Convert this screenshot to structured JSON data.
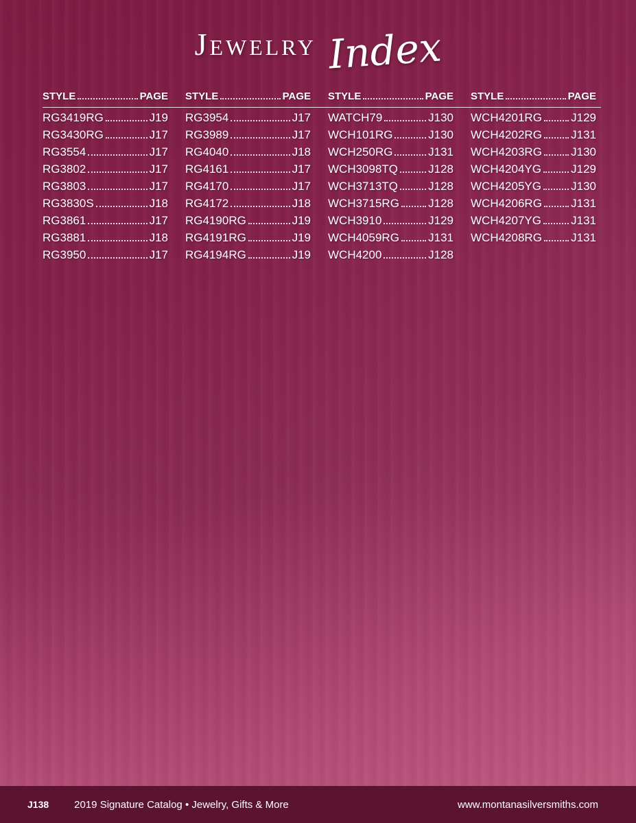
{
  "title": {
    "word1": "Jewelry",
    "word2": "Index"
  },
  "header": {
    "style": "STYLE",
    "page": "PAGE"
  },
  "columns": [
    [
      {
        "style": "RG3419RG",
        "page": "J19"
      },
      {
        "style": "RG3430RG",
        "page": "J17"
      },
      {
        "style": "RG3554",
        "page": "J17"
      },
      {
        "style": "RG3802",
        "page": "J17"
      },
      {
        "style": "RG3803",
        "page": "J17"
      },
      {
        "style": "RG3830S",
        "page": "J18"
      },
      {
        "style": "RG3861",
        "page": "J17"
      },
      {
        "style": "RG3881",
        "page": "J18"
      },
      {
        "style": "RG3950",
        "page": "J17"
      }
    ],
    [
      {
        "style": "RG3954",
        "page": "J17"
      },
      {
        "style": "RG3989",
        "page": "J17"
      },
      {
        "style": "RG4040",
        "page": "J18"
      },
      {
        "style": "RG4161",
        "page": "J17"
      },
      {
        "style": "RG4170",
        "page": "J17"
      },
      {
        "style": "RG4172",
        "page": "J18"
      },
      {
        "style": "RG4190RG",
        "page": "J19"
      },
      {
        "style": "RG4191RG",
        "page": "J19"
      },
      {
        "style": "RG4194RG",
        "page": "J19"
      }
    ],
    [
      {
        "style": "WATCH79",
        "page": "J130"
      },
      {
        "style": "WCH101RG",
        "page": "J130"
      },
      {
        "style": "WCH250RG",
        "page": "J131"
      },
      {
        "style": "WCH3098TQ",
        "page": "J128"
      },
      {
        "style": "WCH3713TQ",
        "page": "J128"
      },
      {
        "style": "WCH3715RG",
        "page": "J128"
      },
      {
        "style": "WCH3910",
        "page": "J129"
      },
      {
        "style": "WCH4059RG",
        "page": "J131"
      },
      {
        "style": "WCH4200",
        "page": "J128"
      }
    ],
    [
      {
        "style": "WCH4201RG",
        "page": "J129"
      },
      {
        "style": "WCH4202RG",
        "page": "J131"
      },
      {
        "style": "WCH4203RG",
        "page": "J130"
      },
      {
        "style": "WCH4204YG",
        "page": "J129"
      },
      {
        "style": "WCH4205YG",
        "page": "J130"
      },
      {
        "style": "WCH4206RG",
        "page": "J131"
      },
      {
        "style": "WCH4207YG",
        "page": "J131"
      },
      {
        "style": "WCH4208RG",
        "page": "J131"
      }
    ]
  ],
  "footer": {
    "page_number": "J138",
    "catalog": "2019 Signature Catalog • Jewelry, Gifts & More",
    "url": "www.montanasilversmiths.com"
  },
  "colors": {
    "background": "#8a2550",
    "footer_band": "#5a1430",
    "text": "#ffffff"
  }
}
